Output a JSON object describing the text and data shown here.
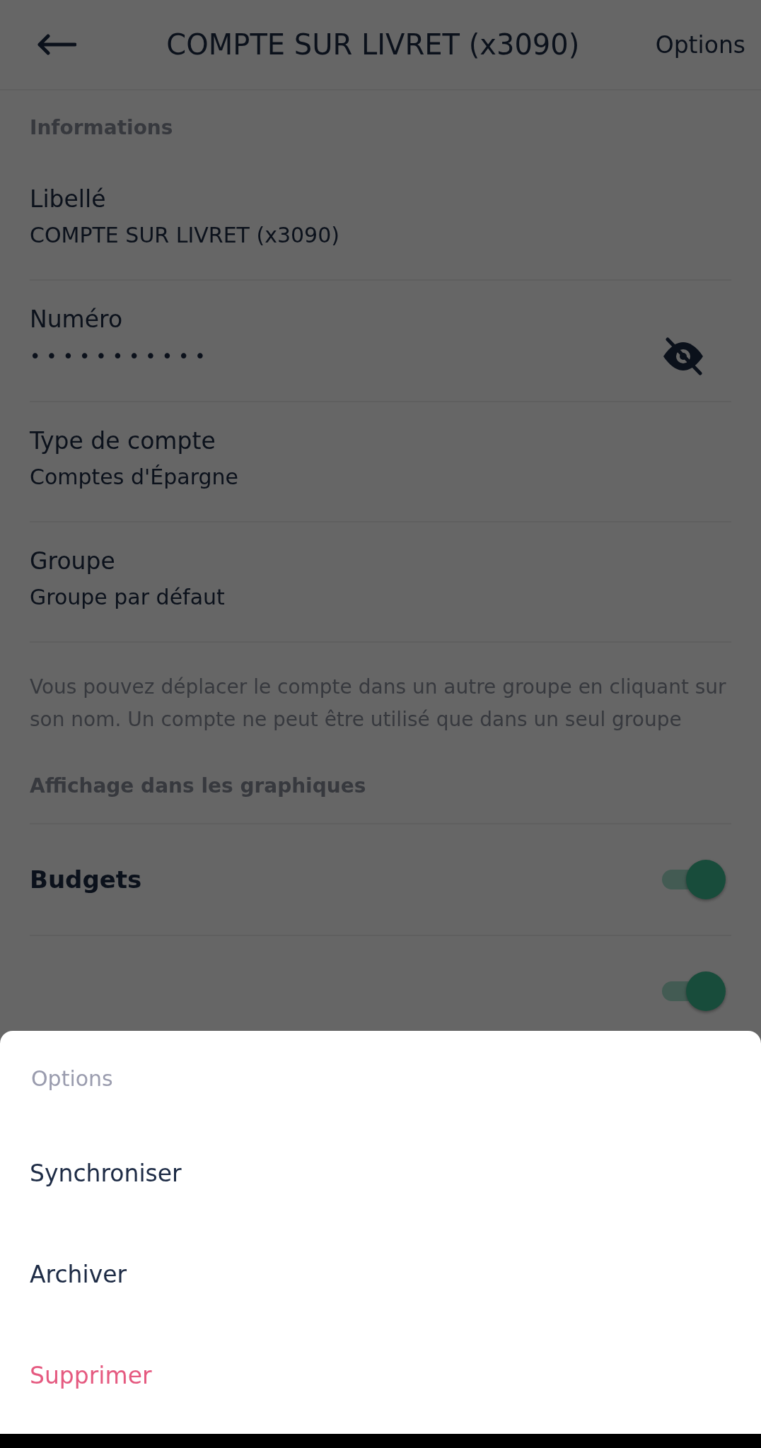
{
  "header": {
    "title": "COMPTE SUR LIVRET (x3090)",
    "action": "Options"
  },
  "informations": {
    "heading": "Informations",
    "fields": [
      {
        "label": "Libellé",
        "value": "COMPTE SUR LIVRET (x3090)",
        "kind": "text"
      },
      {
        "label": "Numéro",
        "value": "•••••••••••",
        "kind": "masked"
      },
      {
        "label": "Type de compte",
        "value": "Comptes d'Épargne",
        "kind": "text"
      },
      {
        "label": "Groupe",
        "value": "Groupe par défaut",
        "kind": "text"
      }
    ],
    "note": "Vous pouvez déplacer le compte dans un autre groupe en cliquant sur son nom. Un compte ne peut être utilisé que dans un seul groupe"
  },
  "display": {
    "heading": "Affichage dans les graphiques",
    "toggles": [
      {
        "label": "Budgets",
        "on": true
      },
      {
        "on": true
      }
    ]
  },
  "sheet": {
    "title": "Options",
    "items": [
      {
        "label": "Synchroniser",
        "kind": "normal"
      },
      {
        "label": "Archiver",
        "kind": "normal"
      },
      {
        "label": "Supprimer",
        "kind": "danger"
      }
    ]
  }
}
